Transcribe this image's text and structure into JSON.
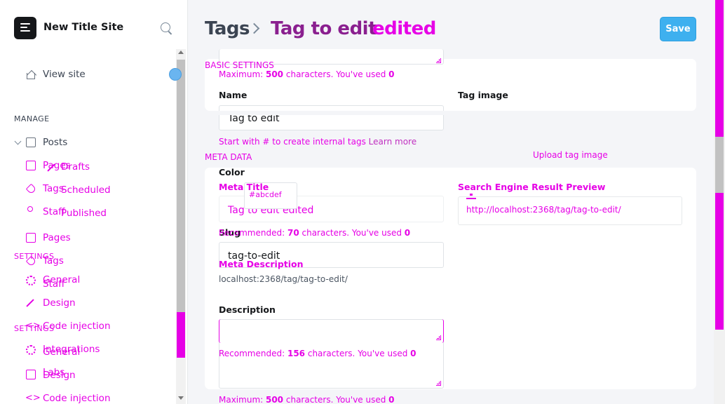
{
  "sidebar": {
    "site_title": "New Title Site",
    "view_site": "View site",
    "manage_heading": "MANAGE",
    "settings_heading_a": "SETTINGS",
    "settings_heading_b": "SETTINGS",
    "nav": {
      "posts": "Posts",
      "pages_overlap": "Pages",
      "drafts": "Drafts",
      "tags_overlap": "Tags",
      "scheduled": "Scheduled",
      "staff_overlap": "Staff",
      "published": "Published",
      "pages": "Pages",
      "tags": "Tags",
      "general_a": "General",
      "staff": "Staff",
      "design_a": "Design",
      "code_injection_a": "Code injection",
      "integrations": "Integrations",
      "general_b": "General",
      "labs": "Labs",
      "design_b": "Design",
      "code_injection_b": "Code injection"
    }
  },
  "header": {
    "crumb_parent": "Tags",
    "crumb_current": "Tag to edit",
    "crumb_suffix": "edited",
    "save_label": "Save"
  },
  "basic": {
    "section_label": "BASIC SETTINGS",
    "max_chars_prefix": "Maximum: ",
    "max_chars_value": "500",
    "max_chars_mid": " characters. You've used ",
    "max_chars_used": "0",
    "name_label": "Name",
    "name_value": "Tag to edit",
    "name_hint": "Start with # to create internal tags",
    "learn_more": "Learn more",
    "tag_image_label": "Tag image",
    "upload_label": "Upload tag image",
    "color_label": "Color",
    "color_placeholder": "#abcdef",
    "slug_label": "Slug",
    "slug_value": "tag-to-edit",
    "slug_url": "localhost:2368/tag/tag-to-edit/",
    "description_label": "Description",
    "desc_max_prefix": "Maximum: ",
    "desc_max_value": "500",
    "desc_max_mid": " characters. You've used ",
    "desc_max_used": "0"
  },
  "meta": {
    "section_label": "META DATA",
    "meta_title_label": "Meta Title",
    "meta_title_value": "Tag to edit edited",
    "meta_title_rec_prefix": "Recommended: ",
    "meta_title_rec_value": "70",
    "meta_title_rec_mid": " characters. You've used ",
    "meta_title_rec_used": "0",
    "meta_description_label": "Meta Description",
    "meta_desc_rec_prefix": "Recommended: ",
    "meta_desc_rec_value": "156",
    "meta_desc_rec_mid": " characters. You've used ",
    "meta_desc_rec_used": "0",
    "preview_label": "Search Engine Result Preview",
    "preview_url": "http://localhost:2368/tag/tag-to-edit/"
  },
  "colors": {
    "accent_overlay": "#e600e6",
    "save_button": "#3eb0ef",
    "background": "#f4f5f8"
  }
}
